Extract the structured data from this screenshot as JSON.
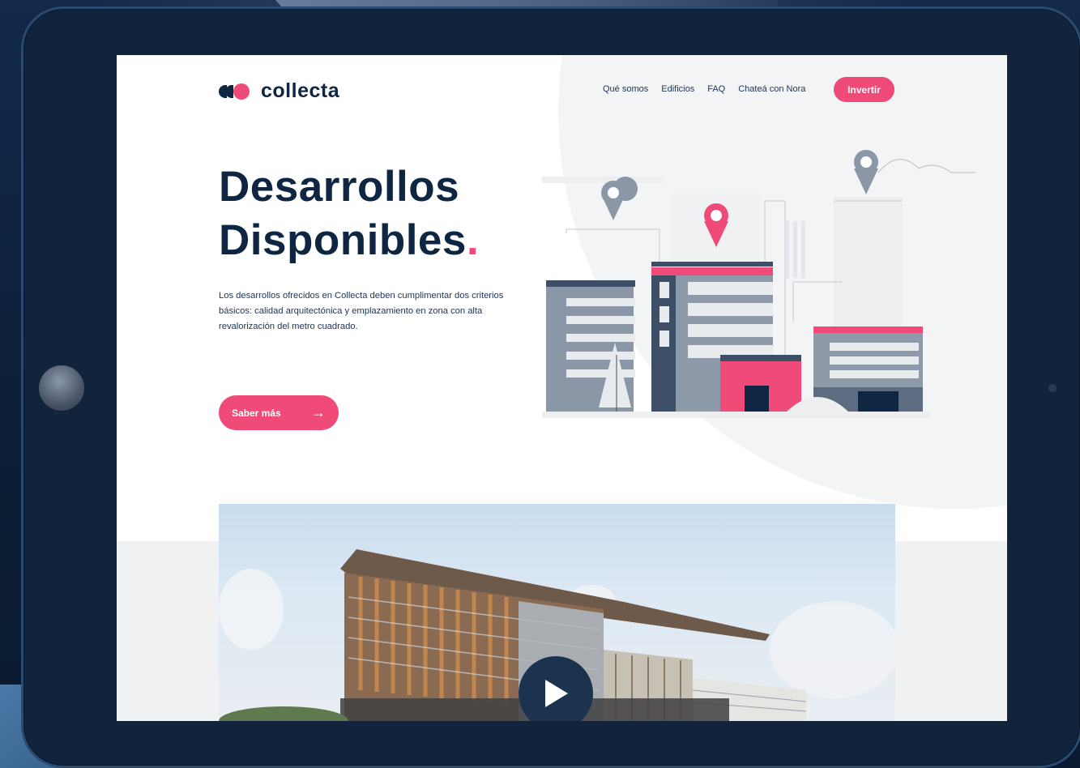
{
  "brand": {
    "name": "collecta",
    "accent": "#ef4a78",
    "navy": "#0e2642"
  },
  "nav": {
    "items": [
      {
        "label": "Qué somos"
      },
      {
        "label": "Edificios"
      },
      {
        "label": "FAQ"
      },
      {
        "label": "Chateá con Nora"
      }
    ],
    "cta_label": "Invertir"
  },
  "hero": {
    "title_line1": "Desarrollos",
    "title_line2": "Disponibles",
    "title_dot": ".",
    "description": "Los desarrollos ofrecidos en Collecta deben cumplimentar dos criterios básicos: calidad arquitectónica y emplazamiento en zona con alta revalorización del metro cuadrado.",
    "button_label": "Saber más",
    "button_icon": "arrow-right-icon"
  },
  "video": {
    "icon": "play-icon"
  }
}
